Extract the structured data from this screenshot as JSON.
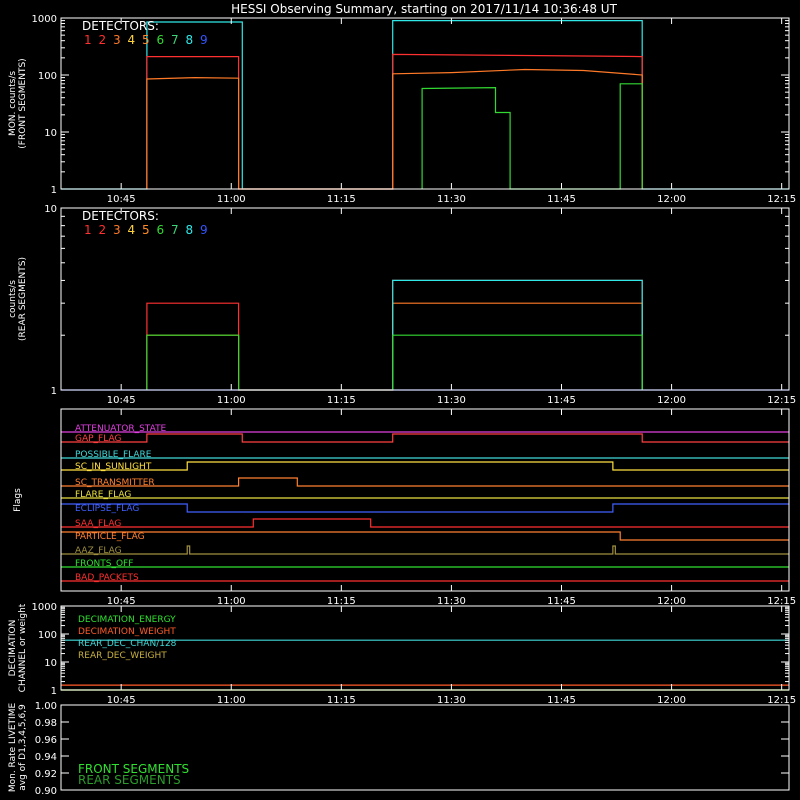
{
  "title": "HESSI Observing Summary, starting on 2017/11/14 10:36:48 UT",
  "colors": {
    "det": [
      "#ff3030",
      "#ff3030",
      "#ff7a28",
      "#ffd23c",
      "#ff8c28",
      "#33d933",
      "#3cd278",
      "#30e8e8",
      "#3355ff"
    ],
    "frame": "#ffffff"
  },
  "chart_data": [
    {
      "id": "front",
      "type": "line",
      "ylabel": [
        "MON. counts/s",
        "(FRONT SEGMENTS)"
      ],
      "yscale": "log",
      "ylim": [
        1,
        1000
      ],
      "yticks": [
        "1",
        "10",
        "100",
        "1000"
      ],
      "xlim": [
        "10:36:48",
        "12:16"
      ],
      "xticks": [
        "10:45",
        "11:00",
        "11:15",
        "11:30",
        "11:45",
        "12:00",
        "12:15"
      ],
      "legend_title": "DETECTORS:",
      "legend_numbers": [
        "1",
        "2",
        "3",
        "4",
        "5",
        "6",
        "7",
        "8",
        "9"
      ],
      "series": [
        {
          "detector": "8",
          "color": "#30e8e8",
          "points": [
            [
              "10:36:48",
              1
            ],
            [
              "10:48:30",
              1
            ],
            [
              "10:48:30",
              850
            ],
            [
              "11:01:30",
              850
            ],
            [
              "11:01:30",
              1
            ],
            [
              "11:22:00",
              1
            ],
            [
              "11:22:00",
              900
            ],
            [
              "11:56:00",
              900
            ],
            [
              "11:56:00",
              1
            ],
            [
              "12:16",
              1
            ]
          ]
        },
        {
          "detector": "1",
          "color": "#ff3030",
          "points": [
            [
              "10:48:30",
              1
            ],
            [
              "10:48:30",
              210
            ],
            [
              "11:01:00",
              210
            ],
            [
              "11:01:00",
              1
            ],
            [
              "11:22:00",
              1
            ],
            [
              "11:22:00",
              230
            ],
            [
              "11:30:00",
              225
            ],
            [
              "11:40:00",
              220
            ],
            [
              "11:50:00",
              215
            ],
            [
              "11:56:00",
              210
            ],
            [
              "11:56:00",
              1
            ]
          ]
        },
        {
          "detector": "3",
          "color": "#ff7a28",
          "points": [
            [
              "10:48:30",
              1
            ],
            [
              "10:48:30",
              85
            ],
            [
              "10:55:00",
              90
            ],
            [
              "11:01:00",
              88
            ],
            [
              "11:01:00",
              1
            ],
            [
              "11:22:00",
              1
            ],
            [
              "11:22:00",
              105
            ],
            [
              "11:30:00",
              110
            ],
            [
              "11:40:00",
              125
            ],
            [
              "11:48:00",
              120
            ],
            [
              "11:56:00",
              100
            ],
            [
              "11:56:00",
              1
            ]
          ]
        },
        {
          "detector": "6",
          "color": "#33d933",
          "points": [
            [
              "11:26:00",
              1
            ],
            [
              "11:26:00",
              58
            ],
            [
              "11:36:00",
              60
            ],
            [
              "11:36:00",
              22
            ],
            [
              "11:38:00",
              22
            ],
            [
              "11:38:00",
              1
            ],
            [
              "11:53:00",
              1
            ],
            [
              "11:53:00",
              70
            ],
            [
              "11:56:00",
              70
            ],
            [
              "11:56:00",
              1
            ]
          ]
        }
      ]
    },
    {
      "id": "rear",
      "type": "line",
      "ylabel": [
        "counts/s",
        "(REAR SEGMENTS)"
      ],
      "yscale": "log",
      "ylim": [
        1,
        10
      ],
      "yticks": [
        "1",
        "10"
      ],
      "xlim": [
        "10:36:48",
        "12:16"
      ],
      "xticks": [
        "10:45",
        "11:00",
        "11:15",
        "11:30",
        "11:45",
        "12:00",
        "12:15"
      ],
      "legend_title": "DETECTORS:",
      "legend_numbers": [
        "1",
        "2",
        "3",
        "4",
        "5",
        "6",
        "7",
        "8",
        "9"
      ],
      "series": [
        {
          "detector": "1",
          "color": "#ff3030",
          "points": [
            [
              "10:48:30",
              1
            ],
            [
              "10:48:30",
              3
            ],
            [
              "11:01:00",
              3
            ],
            [
              "11:01:00",
              1
            ],
            [
              "11:22:00",
              1
            ],
            [
              "11:22:00",
              4
            ],
            [
              "11:56:00",
              4
            ],
            [
              "11:56:00",
              1
            ]
          ]
        },
        {
          "detector": "3",
          "color": "#ff7a28",
          "points": [
            [
              "10:48:30",
              1
            ],
            [
              "10:48:30",
              2
            ],
            [
              "11:01:00",
              2
            ],
            [
              "11:01:00",
              1
            ],
            [
              "11:22:00",
              1
            ],
            [
              "11:22:00",
              3
            ],
            [
              "11:56:00",
              3
            ],
            [
              "11:56:00",
              1
            ]
          ]
        },
        {
          "detector": "8",
          "color": "#30e8e8",
          "points": [
            [
              "11:22:00",
              1
            ],
            [
              "11:22:00",
              4
            ],
            [
              "11:56:00",
              4
            ],
            [
              "11:56:00",
              1
            ]
          ]
        },
        {
          "detector": "6",
          "color": "#33d933",
          "points": [
            [
              "10:48:30",
              1
            ],
            [
              "10:48:30",
              2
            ],
            [
              "11:01:00",
              2
            ],
            [
              "11:01:00",
              1
            ],
            [
              "11:22:00",
              1
            ],
            [
              "11:22:00",
              2
            ],
            [
              "11:56:00",
              2
            ],
            [
              "11:56:00",
              1
            ]
          ]
        },
        {
          "detector": "9",
          "color": "#3355ff",
          "points": [
            [
              "10:36:48",
              1
            ],
            [
              "12:16",
              1
            ]
          ]
        }
      ]
    },
    {
      "id": "flags",
      "type": "line",
      "ylabel": [
        "Flags"
      ],
      "xlim": [
        "10:36:48",
        "12:16"
      ],
      "xticks": [
        "10:45",
        "11:00",
        "11:15",
        "11:30",
        "11:45",
        "12:00",
        "12:15"
      ],
      "flags": [
        {
          "name": "ATTENUATOR_STATE",
          "color": "#e040e0",
          "steps": [
            [
              "10:36:48",
              0
            ],
            [
              "12:16",
              0
            ]
          ]
        },
        {
          "name": "GAP_FLAG",
          "color": "#ff4040",
          "steps": [
            [
              "10:36:48",
              0
            ],
            [
              "10:48:30",
              1
            ],
            [
              "11:01:30",
              0
            ],
            [
              "11:22:00",
              1
            ],
            [
              "11:56:00",
              0
            ],
            [
              "12:16",
              0
            ]
          ]
        },
        {
          "name": "POSSIBLE_FLARE",
          "color": "#40d8d8",
          "steps": [
            [
              "10:36:48",
              0
            ],
            [
              "12:16",
              0
            ]
          ]
        },
        {
          "name": "SC_IN_SUNLIGHT",
          "color": "#ffe040",
          "steps": [
            [
              "10:36:48",
              0
            ],
            [
              "10:54:00",
              1
            ],
            [
              "11:52:00",
              0
            ],
            [
              "12:16",
              0
            ]
          ]
        },
        {
          "name": "SC_TRANSMITTER",
          "color": "#ff8030",
          "steps": [
            [
              "10:36:48",
              0
            ],
            [
              "11:01:00",
              1
            ],
            [
              "11:09:00",
              0
            ],
            [
              "12:16",
              0
            ]
          ]
        },
        {
          "name": "FLARE_FLAG",
          "color": "#e8e040",
          "steps": [
            [
              "10:36:48",
              0
            ],
            [
              "12:16",
              0
            ]
          ]
        },
        {
          "name": "ECLIPSE_FLAG",
          "color": "#4060ff",
          "steps": [
            [
              "10:36:48",
              1
            ],
            [
              "10:54:00",
              0
            ],
            [
              "11:52:00",
              1
            ],
            [
              "12:16",
              1
            ]
          ]
        },
        {
          "name": "SAA_FLAG",
          "color": "#ff3030",
          "steps": [
            [
              "10:36:48",
              0
            ],
            [
              "11:03:00",
              1
            ],
            [
              "11:19:00",
              0
            ],
            [
              "12:16",
              0
            ]
          ]
        },
        {
          "name": "PARTICLE_FLAG",
          "color": "#ff8030",
          "steps": [
            [
              "10:36:48",
              1
            ],
            [
              "11:53:00",
              0
            ],
            [
              "12:16",
              0
            ]
          ]
        },
        {
          "name": "AAZ_FLAG",
          "color": "#a09040",
          "steps": [
            [
              "10:36:48",
              0
            ],
            [
              "10:54:00",
              1
            ],
            [
              "10:54:20",
              0
            ],
            [
              "11:52:00",
              1
            ],
            [
              "11:52:20",
              0
            ],
            [
              "12:16",
              0
            ]
          ]
        },
        {
          "name": "FRONTS_OFF",
          "color": "#30e030",
          "steps": [
            [
              "10:36:48",
              0
            ],
            [
              "12:16",
              0
            ]
          ]
        },
        {
          "name": "BAD_PACKETS",
          "color": "#ff3030",
          "steps": [
            [
              "10:36:48",
              0
            ],
            [
              "12:16",
              0
            ]
          ]
        }
      ]
    },
    {
      "id": "decimation",
      "type": "line",
      "ylabel": [
        "DECIMATION",
        "CHANNEL or weight"
      ],
      "yscale": "log",
      "ylim": [
        1,
        1000
      ],
      "yticks": [
        "1",
        "10",
        "100",
        "1000"
      ],
      "xlim": [
        "10:36:48",
        "12:16"
      ],
      "xticks": [
        "10:45",
        "11:00",
        "11:15",
        "11:30",
        "11:45",
        "12:00",
        "12:15"
      ],
      "series": [
        {
          "name": "DECIMATION_ENERGY",
          "color": "#30e030",
          "points": [
            [
              "10:36:48",
              1
            ],
            [
              "12:16",
              1
            ]
          ]
        },
        {
          "name": "DECIMATION_WEIGHT",
          "color": "#ff5a28",
          "points": [
            [
              "10:36:48",
              1.5
            ],
            [
              "12:16",
              1.5
            ]
          ]
        },
        {
          "name": "REAR_DEC_CHAN/128",
          "color": "#40d8d8",
          "points": [
            [
              "10:36:48",
              60
            ],
            [
              "12:16",
              60
            ]
          ]
        },
        {
          "name": "REAR_DEC_WEIGHT",
          "color": "#c8b040",
          "points": [
            [
              "10:36:48",
              1
            ],
            [
              "12:16",
              1
            ]
          ]
        }
      ]
    },
    {
      "id": "livetime",
      "type": "line",
      "ylabel": [
        "Mon. Rate LIVETIME",
        "avg of D1,3,4,5,6,9"
      ],
      "ylim": [
        0.9,
        1.0
      ],
      "yticks": [
        "0.90",
        "0.92",
        "0.94",
        "0.96",
        "0.98",
        "1.00"
      ],
      "series": [
        {
          "name": "FRONT SEGMENTS",
          "color": "#30e030"
        },
        {
          "name": "REAR SEGMENTS",
          "color": "#2c9c2c"
        }
      ]
    }
  ]
}
